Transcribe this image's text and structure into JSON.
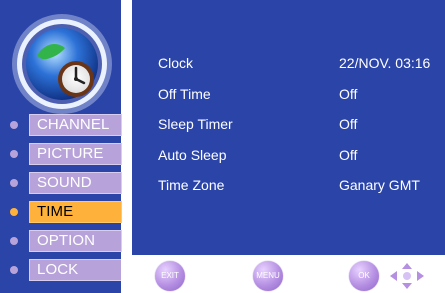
{
  "sidebar": {
    "items": [
      {
        "label": "CHANNEL"
      },
      {
        "label": "PICTURE"
      },
      {
        "label": "SOUND"
      },
      {
        "label": "TIME"
      },
      {
        "label": "OPTION"
      },
      {
        "label": "LOCK"
      }
    ],
    "active_index": 3,
    "icon": "clock-icon"
  },
  "panel": {
    "rows": [
      {
        "label": "Clock",
        "value": "22/NOV. 03:16"
      },
      {
        "label": "Off Time",
        "value": "Off"
      },
      {
        "label": "Sleep Timer",
        "value": "Off"
      },
      {
        "label": "Auto Sleep",
        "value": "Off"
      },
      {
        "label": "Time Zone",
        "value": "Ganary GMT"
      }
    ]
  },
  "buttons": {
    "exit": "EXIT",
    "menu": "MENU",
    "ok": "OK",
    "nav_icon": "directional-arrows-icon"
  },
  "colors": {
    "blue_bg": "#2a44a8",
    "menu_item": "#b7a3d9",
    "active_item": "#ffb23b",
    "text": "#ffffff"
  }
}
